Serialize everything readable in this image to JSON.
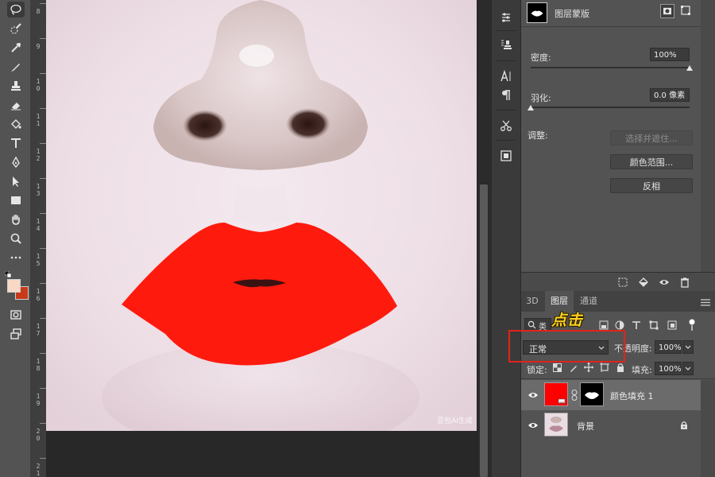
{
  "ruler": {
    "labels": [
      "8",
      "9",
      "1 0",
      "1 1",
      "1 2",
      "1 3",
      "1 4",
      "1 5",
      "1 6",
      "1 7",
      "1 8",
      "1 9",
      "2 0",
      "2 1"
    ]
  },
  "canvas": {
    "watermark": "豆包AI生成"
  },
  "properties": {
    "header_title": "图层蒙版",
    "density_label": "密度:",
    "density_value": "100%",
    "density_level": 1.0,
    "feather_label": "羽化:",
    "feather_value": "0.0 像素",
    "feather_level": 0.0,
    "adjust_label": "调整:",
    "select_mask_button": "选择并遮住...",
    "color_range_button": "颜色范围...",
    "invert_button": "反相"
  },
  "layers_panel": {
    "tabs": [
      "3D",
      "图层",
      "通道"
    ],
    "active_tab": "图层",
    "filter_prefix": "类",
    "blend_mode": "正常",
    "opacity_label": "不透明度:",
    "opacity_value": "100%",
    "lock_label": "锁定:",
    "fill_label": "填充:",
    "fill_value": "100%",
    "layers": [
      {
        "name": "颜色填充 1",
        "fill_color": "#ff0000",
        "selected": true
      },
      {
        "name": "背景",
        "locked": true,
        "selected": false
      }
    ]
  },
  "annotation": {
    "text": "点击",
    "box_color": "#e2231a",
    "text_color": "#ffd21f"
  },
  "colors": {
    "foreground": "#f7d9c6",
    "background": "#c83a18",
    "lip_fill": "#ff1a0e"
  }
}
